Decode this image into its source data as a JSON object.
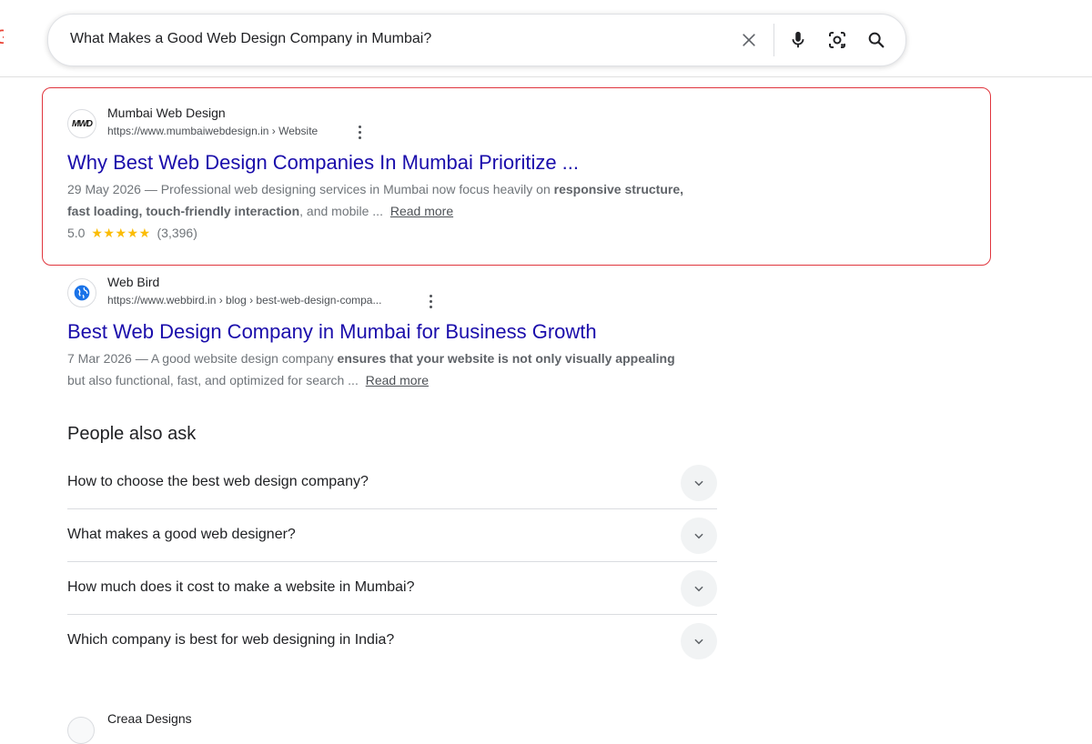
{
  "search": {
    "query": "What Makes a Good Web Design Company in Mumbai?"
  },
  "icons": {
    "clear": "close-icon",
    "voice": "microphone-icon",
    "lens": "camera-lens-icon",
    "search": "search-icon",
    "more": "more-vert-icon",
    "chevron": "chevron-down-icon",
    "globe": "globe-icon"
  },
  "colors": {
    "link": "#1a0dab",
    "highlight_border": "#e0353d",
    "star": "#fbbc04"
  },
  "results": [
    {
      "favicon_text": "MWD",
      "site_name": "Mumbai Web Design",
      "url": "https://www.mumbaiwebdesign.in › Website",
      "title": "Why Best Web Design Companies In Mumbai Prioritize ...",
      "date": "29 May 2026",
      "snippet_a": "Professional web designing services in Mumbai now focus heavily on ",
      "snippet_b": "responsive structure, fast loading, touch-friendly interaction",
      "snippet_c": ", and mobile ...",
      "read_more": "Read more",
      "rating": "5.0",
      "stars": 5,
      "reviews": "(3,396)"
    },
    {
      "site_name": "Web Bird",
      "url": "https://www.webbird.in › blog › best-web-design-compa...",
      "title": "Best Web Design Company in Mumbai for Business Growth",
      "date": "7 Mar 2026",
      "snippet_a": "A good website design company ",
      "snippet_b": "ensures that your website is not only visually appealing",
      "snippet_c": " but also functional, fast, and optimized for search ...",
      "read_more": "Read more"
    },
    {
      "site_name": "Creaa Designs"
    }
  ],
  "people_also_ask": {
    "title": "People also ask",
    "questions": [
      "How to choose the best web design company?",
      "What makes a good web designer?",
      "How much does it cost to make a website in Mumbai?",
      "Which company is best for web designing in India?"
    ]
  }
}
